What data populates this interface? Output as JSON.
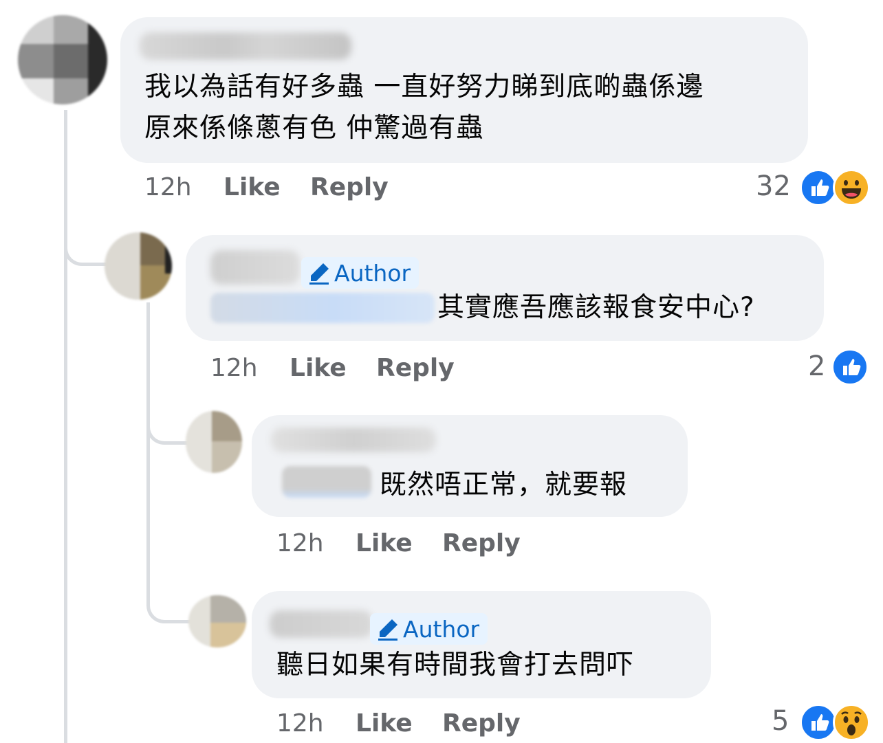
{
  "comments": [
    {
      "text_lines": [
        "我以為話有好多蟲 一直好努力睇到底啲蟲係邊",
        "原來係條蔥有色 仲驚過有蟲"
      ],
      "time": "12h",
      "like_label": "Like",
      "reply_label": "Reply",
      "reaction_count": "32",
      "reactions": [
        "like-icon",
        "haha-icon"
      ]
    },
    {
      "author_badge": "Author",
      "text": "其實應吾應該報食安中心?",
      "time": "12h",
      "like_label": "Like",
      "reply_label": "Reply",
      "reaction_count": "2",
      "reactions": [
        "like-icon"
      ]
    },
    {
      "text": "既然唔正常，就要報",
      "time": "12h",
      "like_label": "Like",
      "reply_label": "Reply"
    },
    {
      "author_badge": "Author",
      "text": "聽日如果有時間我會打去問吓",
      "time": "12h",
      "like_label": "Like",
      "reply_label": "Reply",
      "reaction_count": "5",
      "reactions": [
        "like-icon",
        "wow-icon"
      ]
    }
  ],
  "colors": {
    "bubble": "#f0f2f5",
    "meta_text": "#65676b",
    "like_blue": "#1877f2",
    "author_blue": "#0a66c2",
    "reaction_yellow": "#f7b125"
  }
}
